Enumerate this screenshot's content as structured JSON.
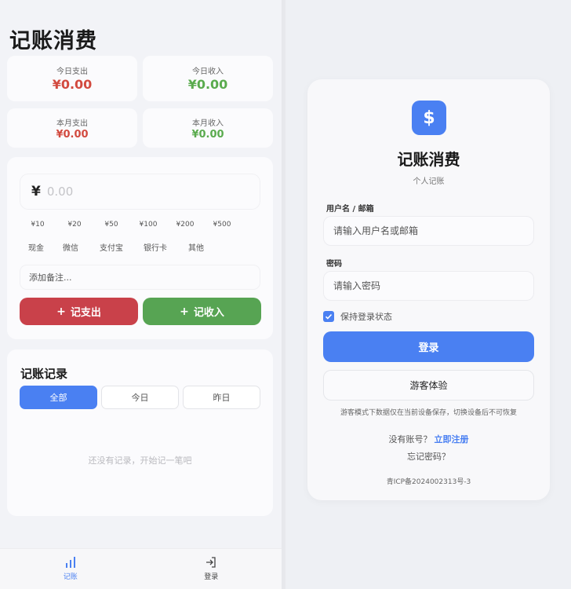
{
  "app": {
    "title": "记账消费",
    "stats": {
      "today_expense": {
        "label": "今日支出",
        "value": "¥0.00"
      },
      "today_income": {
        "label": "今日收入",
        "value": "¥0.00"
      },
      "month_expense": {
        "label": "本月支出",
        "value": "¥0.00"
      },
      "month_income": {
        "label": "本月收入",
        "value": "¥0.00"
      }
    },
    "entry": {
      "currency_symbol": "¥",
      "amount_placeholder": "0.00",
      "quick_amounts": [
        "¥10",
        "¥20",
        "¥50",
        "¥100",
        "¥200",
        "¥500"
      ],
      "payment_methods": [
        "现金",
        "微信",
        "支付宝",
        "银行卡",
        "其他"
      ],
      "note_placeholder": "添加备注...",
      "expense_button": "记支出",
      "income_button": "记收入",
      "plus": "+"
    },
    "records": {
      "title": "记账记录",
      "tabs": [
        "全部",
        "今日",
        "昨日"
      ],
      "active_tab": "全部",
      "empty_text": "还没有记录，开始记一笔吧"
    },
    "nav": {
      "items": [
        {
          "label": "记账",
          "icon": "bar-chart-icon",
          "active": true
        },
        {
          "label": "登录",
          "icon": "login-icon",
          "active": false
        }
      ]
    }
  },
  "login": {
    "logo_symbol": "$",
    "title": "记账消费",
    "subtitle": "个人记账",
    "username_label": "用户名 / 邮箱",
    "username_placeholder": "请输入用户名或邮箱",
    "password_label": "密码",
    "password_placeholder": "请输入密码",
    "remember_label": "保持登录状态",
    "remember_checked": true,
    "login_button": "登录",
    "guest_button": "游客体验",
    "guest_note": "游客模式下数据仅在当前设备保存，切换设备后不可恢复",
    "no_account_text": "没有账号？",
    "register_link": "立即注册",
    "forgot_link": "忘记密码？",
    "icp": "青ICP备2024002313号-3"
  },
  "colors": {
    "accent": "#4a80f2",
    "expense": "#d24a3f",
    "income": "#5aab4e",
    "expense_button": "#c9414a",
    "income_button": "#57a453"
  }
}
